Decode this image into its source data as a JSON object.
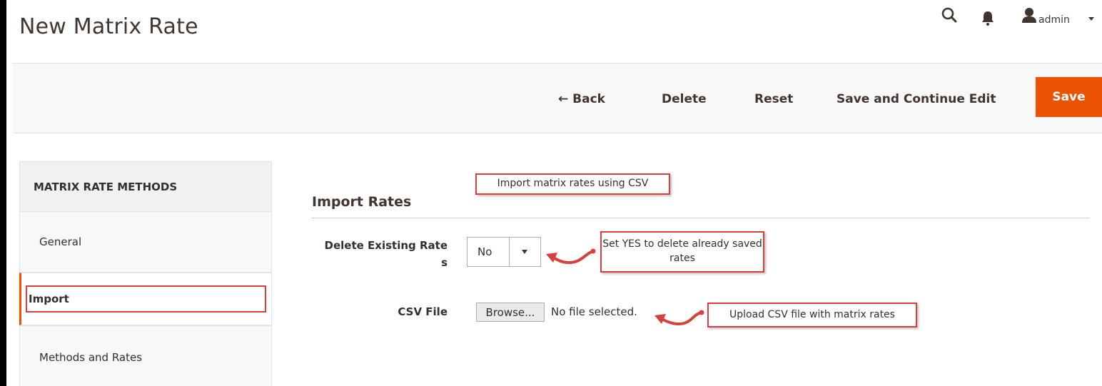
{
  "header": {
    "page_title": "New Matrix Rate",
    "user_name": "admin"
  },
  "toolbar": {
    "back_label": "← Back",
    "delete_label": "Delete",
    "reset_label": "Reset",
    "save_continue_label": "Save and Continue Edit",
    "save_label": "Save"
  },
  "sidebar": {
    "title": "MATRIX RATE METHODS",
    "items": [
      {
        "label": "General"
      },
      {
        "label": "Import"
      },
      {
        "label": "Methods and Rates"
      }
    ]
  },
  "section": {
    "title": "Import Rates",
    "delete_label": "Delete Existing Rate\ns",
    "delete_value": "No",
    "csv_label": "CSV File",
    "browse_label": "Browse...",
    "file_status": "No file selected."
  },
  "annotations": {
    "top": "Import matrix rates using CSV",
    "delete": "Set YES to delete already saved rates",
    "csv": "Upload CSV file with matrix rates"
  },
  "colors": {
    "accent": "#eb5202",
    "annotation": "#d9403b"
  }
}
